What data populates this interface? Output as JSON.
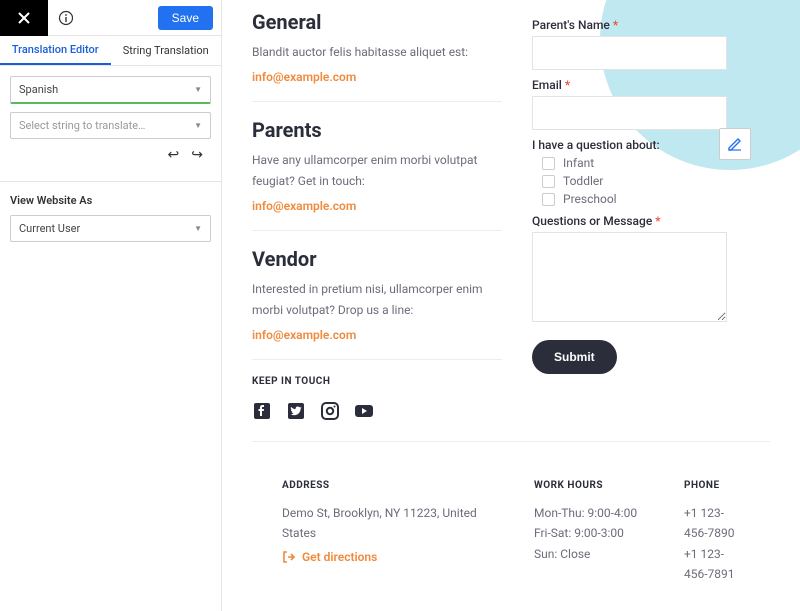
{
  "sidebar": {
    "save": "Save",
    "tabs": {
      "editor": "Translation Editor",
      "string": "String Translation"
    },
    "language": "Spanish",
    "placeholder": "Select string to translate…",
    "view_as": "View Website As",
    "current_user": "Current User"
  },
  "general": {
    "title": "General",
    "desc": "Blandit auctor felis habitasse aliquet est:",
    "email": "info@example.com"
  },
  "parents": {
    "title": "Parents",
    "desc": "Have any ullamcorper enim morbi volutpat feugiat? Get in touch:",
    "email": "info@example.com"
  },
  "vendor": {
    "title": "Vendor",
    "desc": "Interested in pretium nisi, ullamcorper enim morbi volutpat? Drop us a line:",
    "email": "info@example.com"
  },
  "keep_in_touch": "KEEP IN TOUCH",
  "form": {
    "parent_name": "Parent's Name",
    "email_label": "Email",
    "question_about": "I have a question about:",
    "opts": {
      "infant": "Infant",
      "toddler": "Toddler",
      "preschool": "Preschool"
    },
    "questions": "Questions or Message",
    "submit": "Submit"
  },
  "footer": {
    "address_h": "ADDRESS",
    "address": "Demo St, Brooklyn, NY 11223, United States",
    "directions": "Get directions",
    "hours_h": "WORK HOURS",
    "hours1": "Mon-Thu: 9:00-4:00",
    "hours2": "Fri-Sat: 9:00-3:00",
    "hours3": "Sun: Close",
    "phone_h": "PHONE",
    "phone1": "+1 123-456-7890",
    "phone2": "+1 123-456-7891"
  }
}
